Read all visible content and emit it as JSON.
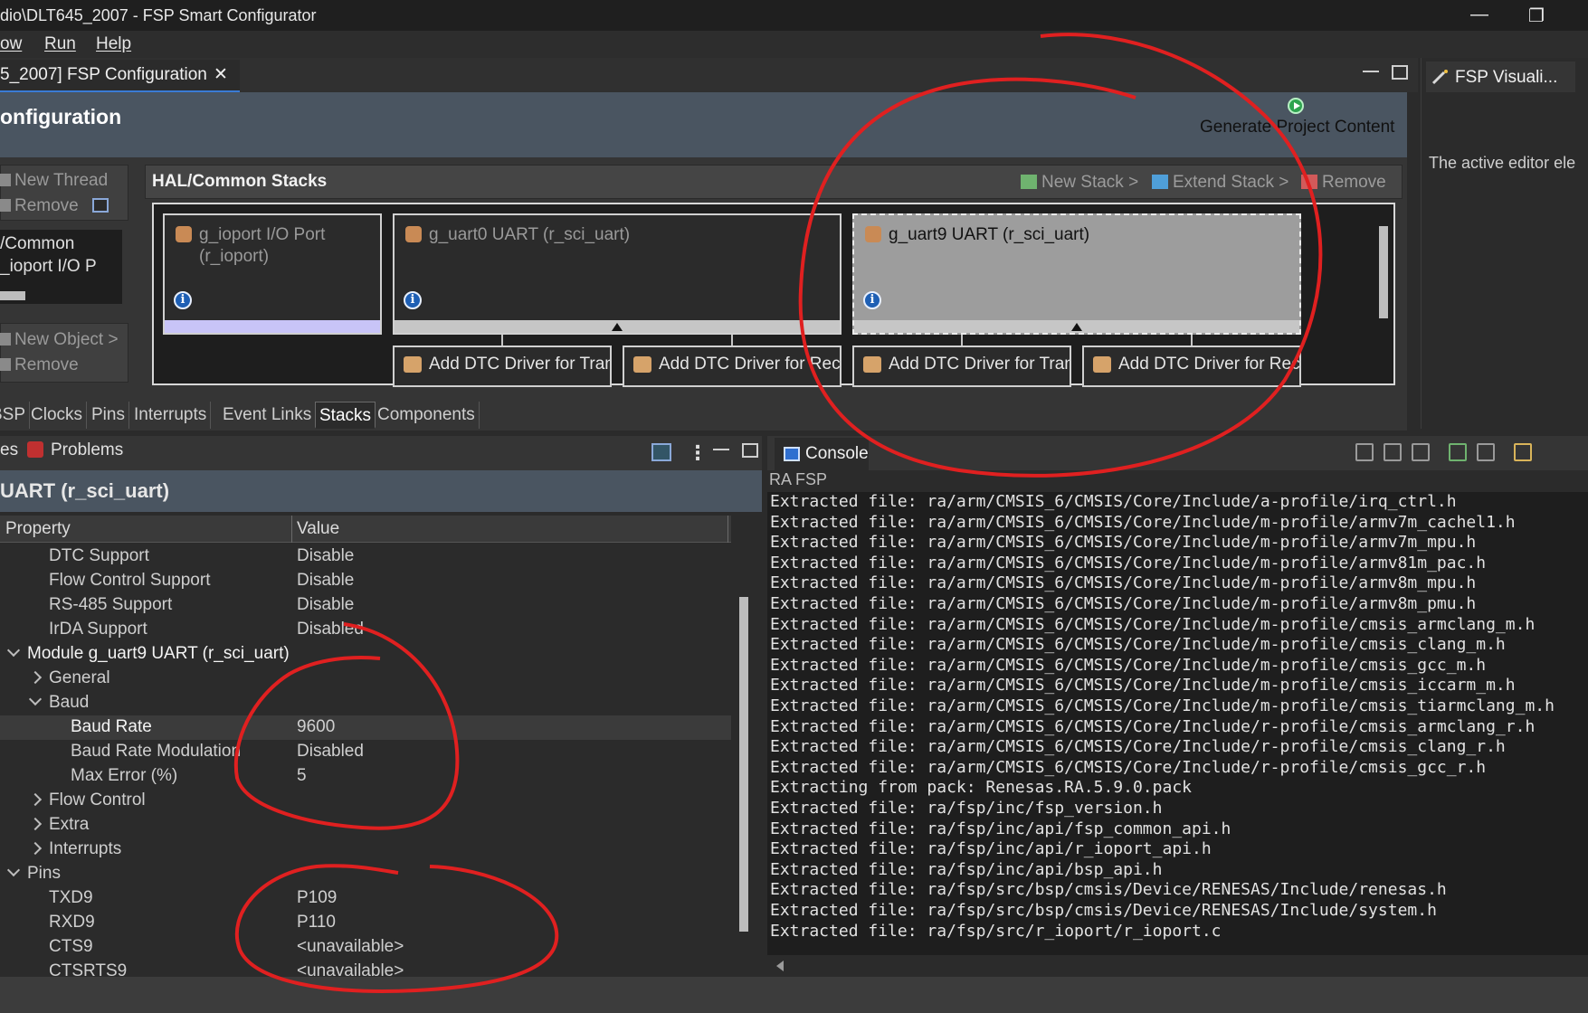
{
  "window": {
    "title": "dio\\DLT645_2007 - FSP Smart Configurator",
    "minimize_glyph": "—",
    "restore_glyph": "❐"
  },
  "menu": [
    "ow",
    "Run",
    "Help"
  ],
  "editor_tab": {
    "label": "5_2007] FSP Configuration",
    "close_glyph": "✕"
  },
  "right_panel": {
    "tab_label": "FSP Visuali...",
    "message": "The active editor ele"
  },
  "config_header": {
    "title": "onfiguration",
    "generate_label": "Generate Project Content"
  },
  "threads": {
    "new_thread": "New Thread",
    "remove_thread": "Remove",
    "list": [
      "/Common",
      "_ioport I/O P"
    ],
    "new_object": "New Object >",
    "remove_object": "Remove"
  },
  "stacks": {
    "title": "HAL/Common Stacks",
    "new_stack": "New Stack >",
    "extend_stack": "Extend Stack >",
    "remove": "Remove",
    "modules": [
      {
        "name": "g_ioport I/O Port (r_ioport)",
        "selected": false
      },
      {
        "name": "g_uart0 UART (r_sci_uart)",
        "selected": false
      },
      {
        "name": "g_uart9 UART (r_sci_uart)",
        "selected": true
      }
    ],
    "sub_modules": [
      "Add DTC Driver for Transmission",
      "Add DTC Driver for Reception [Not",
      "Add DTC Driver for Transmission",
      "Add DTC Driver for Reception [Not"
    ],
    "info_glyph": "i"
  },
  "config_tabs": [
    "BSP",
    "Clocks",
    "Pins",
    "Interrupts",
    "Event Links",
    "Stacks",
    "Components"
  ],
  "config_tabs_active": "Stacks",
  "lower_left": {
    "tab_properties": "es",
    "tab_problems": "Problems",
    "title": "UART (r_sci_uart)",
    "columns": {
      "property": "Property",
      "value": "Value"
    },
    "rows": [
      {
        "key": "DTC Support",
        "value": "Disable",
        "indent": 2,
        "arrow": ""
      },
      {
        "key": "Flow Control Support",
        "value": "Disable",
        "indent": 2,
        "arrow": ""
      },
      {
        "key": "RS-485 Support",
        "value": "Disable",
        "indent": 2,
        "arrow": ""
      },
      {
        "key": "IrDA Support",
        "value": "Disabled",
        "indent": 2,
        "arrow": ""
      },
      {
        "key": "Module g_uart9 UART (r_sci_uart)",
        "value": "",
        "indent": 1,
        "arrow": "down",
        "hl": true
      },
      {
        "key": "General",
        "value": "",
        "indent": 2,
        "arrow": "right"
      },
      {
        "key": "Baud",
        "value": "",
        "indent": 2,
        "arrow": "down"
      },
      {
        "key": "Baud Rate",
        "value": "9600",
        "indent": 3,
        "arrow": "",
        "hl": true,
        "sel": true
      },
      {
        "key": "Baud Rate Modulation",
        "value": "Disabled",
        "indent": 3,
        "arrow": ""
      },
      {
        "key": "Max Error (%)",
        "value": "5",
        "indent": 3,
        "arrow": ""
      },
      {
        "key": "Flow Control",
        "value": "",
        "indent": 2,
        "arrow": "right"
      },
      {
        "key": "Extra",
        "value": "",
        "indent": 2,
        "arrow": "right"
      },
      {
        "key": "Interrupts",
        "value": "",
        "indent": 2,
        "arrow": "right"
      },
      {
        "key": "Pins",
        "value": "",
        "indent": 1,
        "arrow": "down"
      },
      {
        "key": "TXD9",
        "value": "P109",
        "indent": 2,
        "arrow": ""
      },
      {
        "key": "RXD9",
        "value": "P110",
        "indent": 2,
        "arrow": ""
      },
      {
        "key": "CTS9",
        "value": "<unavailable>",
        "indent": 2,
        "arrow": ""
      },
      {
        "key": "CTSRTS9",
        "value": "<unavailable>",
        "indent": 2,
        "arrow": ""
      }
    ]
  },
  "console": {
    "tab_label": "Console",
    "subtitle": "RA FSP",
    "lines": [
      "Extracted file: ra/arm/CMSIS_6/CMSIS/Core/Include/a-profile/irq_ctrl.h",
      "Extracted file: ra/arm/CMSIS_6/CMSIS/Core/Include/m-profile/armv7m_cachel1.h",
      "Extracted file: ra/arm/CMSIS_6/CMSIS/Core/Include/m-profile/armv7m_mpu.h",
      "Extracted file: ra/arm/CMSIS_6/CMSIS/Core/Include/m-profile/armv81m_pac.h",
      "Extracted file: ra/arm/CMSIS_6/CMSIS/Core/Include/m-profile/armv8m_mpu.h",
      "Extracted file: ra/arm/CMSIS_6/CMSIS/Core/Include/m-profile/armv8m_pmu.h",
      "Extracted file: ra/arm/CMSIS_6/CMSIS/Core/Include/m-profile/cmsis_armclang_m.h",
      "Extracted file: ra/arm/CMSIS_6/CMSIS/Core/Include/m-profile/cmsis_clang_m.h",
      "Extracted file: ra/arm/CMSIS_6/CMSIS/Core/Include/m-profile/cmsis_gcc_m.h",
      "Extracted file: ra/arm/CMSIS_6/CMSIS/Core/Include/m-profile/cmsis_iccarm_m.h",
      "Extracted file: ra/arm/CMSIS_6/CMSIS/Core/Include/m-profile/cmsis_tiarmclang_m.h",
      "Extracted file: ra/arm/CMSIS_6/CMSIS/Core/Include/r-profile/cmsis_armclang_r.h",
      "Extracted file: ra/arm/CMSIS_6/CMSIS/Core/Include/r-profile/cmsis_clang_r.h",
      "Extracted file: ra/arm/CMSIS_6/CMSIS/Core/Include/r-profile/cmsis_gcc_r.h",
      "Extracting from pack: Renesas.RA.5.9.0.pack",
      "Extracted file: ra/fsp/inc/fsp_version.h",
      "Extracted file: ra/fsp/inc/api/fsp_common_api.h",
      "Extracted file: ra/fsp/inc/api/r_ioport_api.h",
      "Extracted file: ra/fsp/inc/api/bsp_api.h",
      "Extracted file: ra/fsp/src/bsp/cmsis/Device/RENESAS/Include/renesas.h",
      "Extracted file: ra/fsp/src/bsp/cmsis/Device/RENESAS/Include/system.h",
      "Extracted file: ra/fsp/src/r_ioport/r_ioport.c"
    ]
  },
  "colors": {
    "annotation": "#e02020",
    "header_bg": "#4a5561",
    "selected_module": "#9d9d9d"
  }
}
